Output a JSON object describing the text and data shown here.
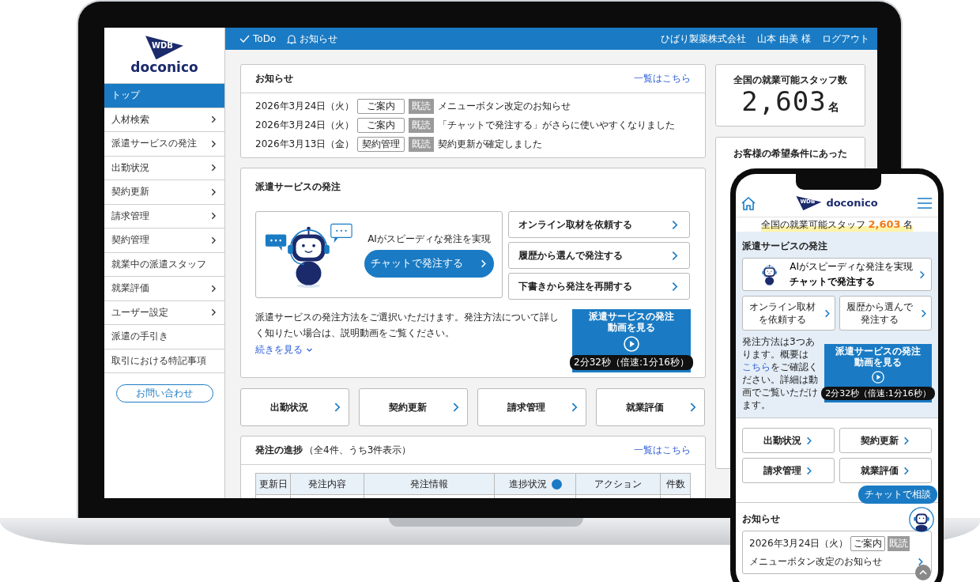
{
  "laptop": {
    "sidebar": {
      "logo": {
        "badge": "WDB",
        "wordmark": "doconico"
      },
      "items": [
        {
          "label": "トップ",
          "selected": true,
          "has_submenu": false
        },
        {
          "label": "人材検索",
          "selected": false,
          "has_submenu": true
        },
        {
          "label": "派遣サービスの発注",
          "selected": false,
          "has_submenu": true
        },
        {
          "label": "出勤状況",
          "selected": false,
          "has_submenu": true
        },
        {
          "label": "契約更新",
          "selected": false,
          "has_submenu": true
        },
        {
          "label": "請求管理",
          "selected": false,
          "has_submenu": true
        },
        {
          "label": "契約管理",
          "selected": false,
          "has_submenu": true
        },
        {
          "label": "就業中の派遣スタッフ",
          "selected": false,
          "has_submenu": false
        },
        {
          "label": "就業評価",
          "selected": false,
          "has_submenu": true
        },
        {
          "label": "ユーザー設定",
          "selected": false,
          "has_submenu": true
        },
        {
          "label": "派遣の手引き",
          "selected": false,
          "has_submenu": false
        },
        {
          "label": "取引における特記事項",
          "selected": false,
          "has_submenu": false
        }
      ],
      "contact_button": "お問い合わせ"
    },
    "topbar": {
      "links": [
        {
          "kind": "todo",
          "label": "ToDo"
        },
        {
          "kind": "notice",
          "label": "お知らせ"
        }
      ],
      "company": "ひばり製薬株式会社",
      "user": "山本 由美 様",
      "logout": "ログアウト"
    },
    "notices": {
      "title": "お知らせ",
      "link": "一覧はこちら",
      "rows": [
        {
          "date": "2026年3月24日（火）",
          "tag": "ご案内",
          "read_badge": "既読",
          "title": "メニューボタン改定のお知らせ"
        },
        {
          "date": "2026年3月24日（火）",
          "tag": "ご案内",
          "read_badge": "既読",
          "title": "「チャットで発注する」がさらに使いやすくなりました"
        },
        {
          "date": "2026年3月13日（金）",
          "tag": "契約管理",
          "read_badge": "既読",
          "title": "契約更新が確定しました"
        }
      ]
    },
    "order_service": {
      "title": "派遣サービスの発注",
      "chat_promo": {
        "caption": "AIがスピーディな発注を実現",
        "button": "チャットで発注する"
      },
      "options": [
        "オンライン取材を依頼する",
        "履歴から選んで発注する",
        "下書きから発注を再開する"
      ],
      "description": "派遣サービスの発注方法をご選択いただけます。発注方法について詳しく知りたい場合は、説明動画をご覧ください。",
      "more_link": "続きを見る",
      "video": {
        "title_lines": [
          "派遣サービスの発注",
          "動画を見る"
        ],
        "duration": "2分32秒（倍速:1分16秒）"
      }
    },
    "quick_links": [
      "出勤状況",
      "契約更新",
      "請求管理",
      "就業評価"
    ],
    "progress": {
      "title": "発注の進捗",
      "count": "（全4件、うち3件表示）",
      "link": "一覧はこちら",
      "columns": [
        {
          "label": "更新日",
          "help": false
        },
        {
          "label": "発注内容",
          "help": false
        },
        {
          "label": "発注情報",
          "help": false
        },
        {
          "label": "進捗状況",
          "help": true
        },
        {
          "label": "アクション",
          "help": false
        },
        {
          "label": "件数",
          "help": false
        }
      ]
    },
    "staff_count": {
      "label": "全国の就業可能スタッフ数",
      "number": "2,603",
      "unit": "名"
    },
    "proposal": {
      "title": "お客様の希望条件にあった"
    }
  },
  "phone": {
    "logo": {
      "badge": "WDB",
      "wordmark": "doconico"
    },
    "banner": {
      "label": "全国の就業可能スタッフ",
      "number": "2,603",
      "unit": "名"
    },
    "order_service": {
      "title": "派遣サービスの発注",
      "chat_button": {
        "caption": "AIがスピーディな発注を実現",
        "label": "チャットで発注する"
      },
      "options": [
        "オンライン取材を依頼する",
        "履歴から選んで発注する"
      ],
      "description": {
        "before": "発注方法は3つあります。概要は",
        "link": "こちら",
        "after": "をご確認ください。詳細は動画でご覧いただけます。"
      },
      "video": {
        "title_lines": [
          "派遣サービスの発注",
          "動画を見る"
        ],
        "duration": "2分32秒（倍速:1分16秒）"
      }
    },
    "quick_links": [
      "出勤状況",
      "契約更新",
      "請求管理",
      "就業評価"
    ],
    "notices": {
      "title": "お知らせ",
      "rows": [
        {
          "date": "2026年3月24日（火）",
          "tag": "ご案内",
          "read_badge": "既読",
          "title": "メニューボタン改定のお知らせ"
        }
      ]
    },
    "chat_bubble": "チャットで相談"
  }
}
